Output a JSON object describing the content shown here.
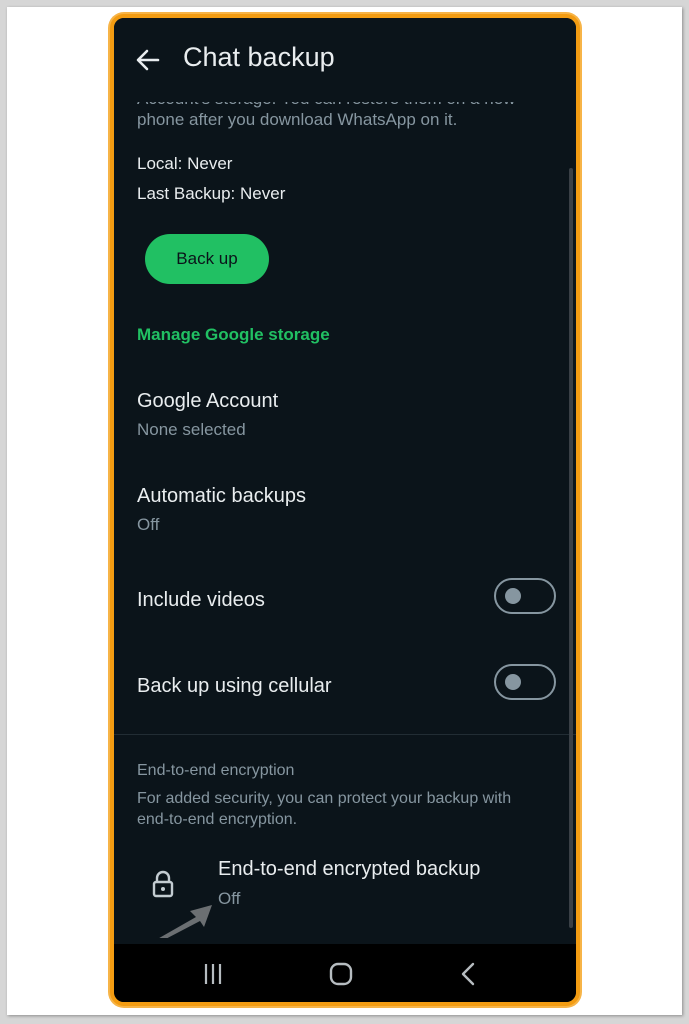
{
  "header": {
    "title": "Chat backup",
    "back_icon": "arrow-left-icon"
  },
  "backup_info": {
    "description_partial": "Account's storage. You can restore them on a new phone after you download WhatsApp on it.",
    "local": "Local: Never",
    "last_backup": "Last Backup: Never",
    "backup_button": "Back up",
    "manage_link": "Manage Google storage"
  },
  "settings": {
    "google_account": {
      "title": "Google Account",
      "value": "None selected"
    },
    "automatic_backups": {
      "title": "Automatic backups",
      "value": "Off"
    },
    "include_videos": {
      "title": "Include videos",
      "enabled": false
    },
    "cellular": {
      "title": "Back up using cellular",
      "enabled": false
    }
  },
  "encryption": {
    "header": "End-to-end encryption",
    "description": "For added security, you can protect your backup with end-to-end encryption.",
    "item_title": "End-to-end encrypted backup",
    "item_value": "Off",
    "icon": "lock-icon"
  },
  "navigation": {
    "icons": [
      "recent-apps-icon",
      "home-icon",
      "back-icon"
    ]
  },
  "colors": {
    "background": "#0b141a",
    "accent": "#21c063",
    "frame": "#f39c12",
    "text_primary": "#e9edef",
    "text_secondary": "#8696a0"
  }
}
